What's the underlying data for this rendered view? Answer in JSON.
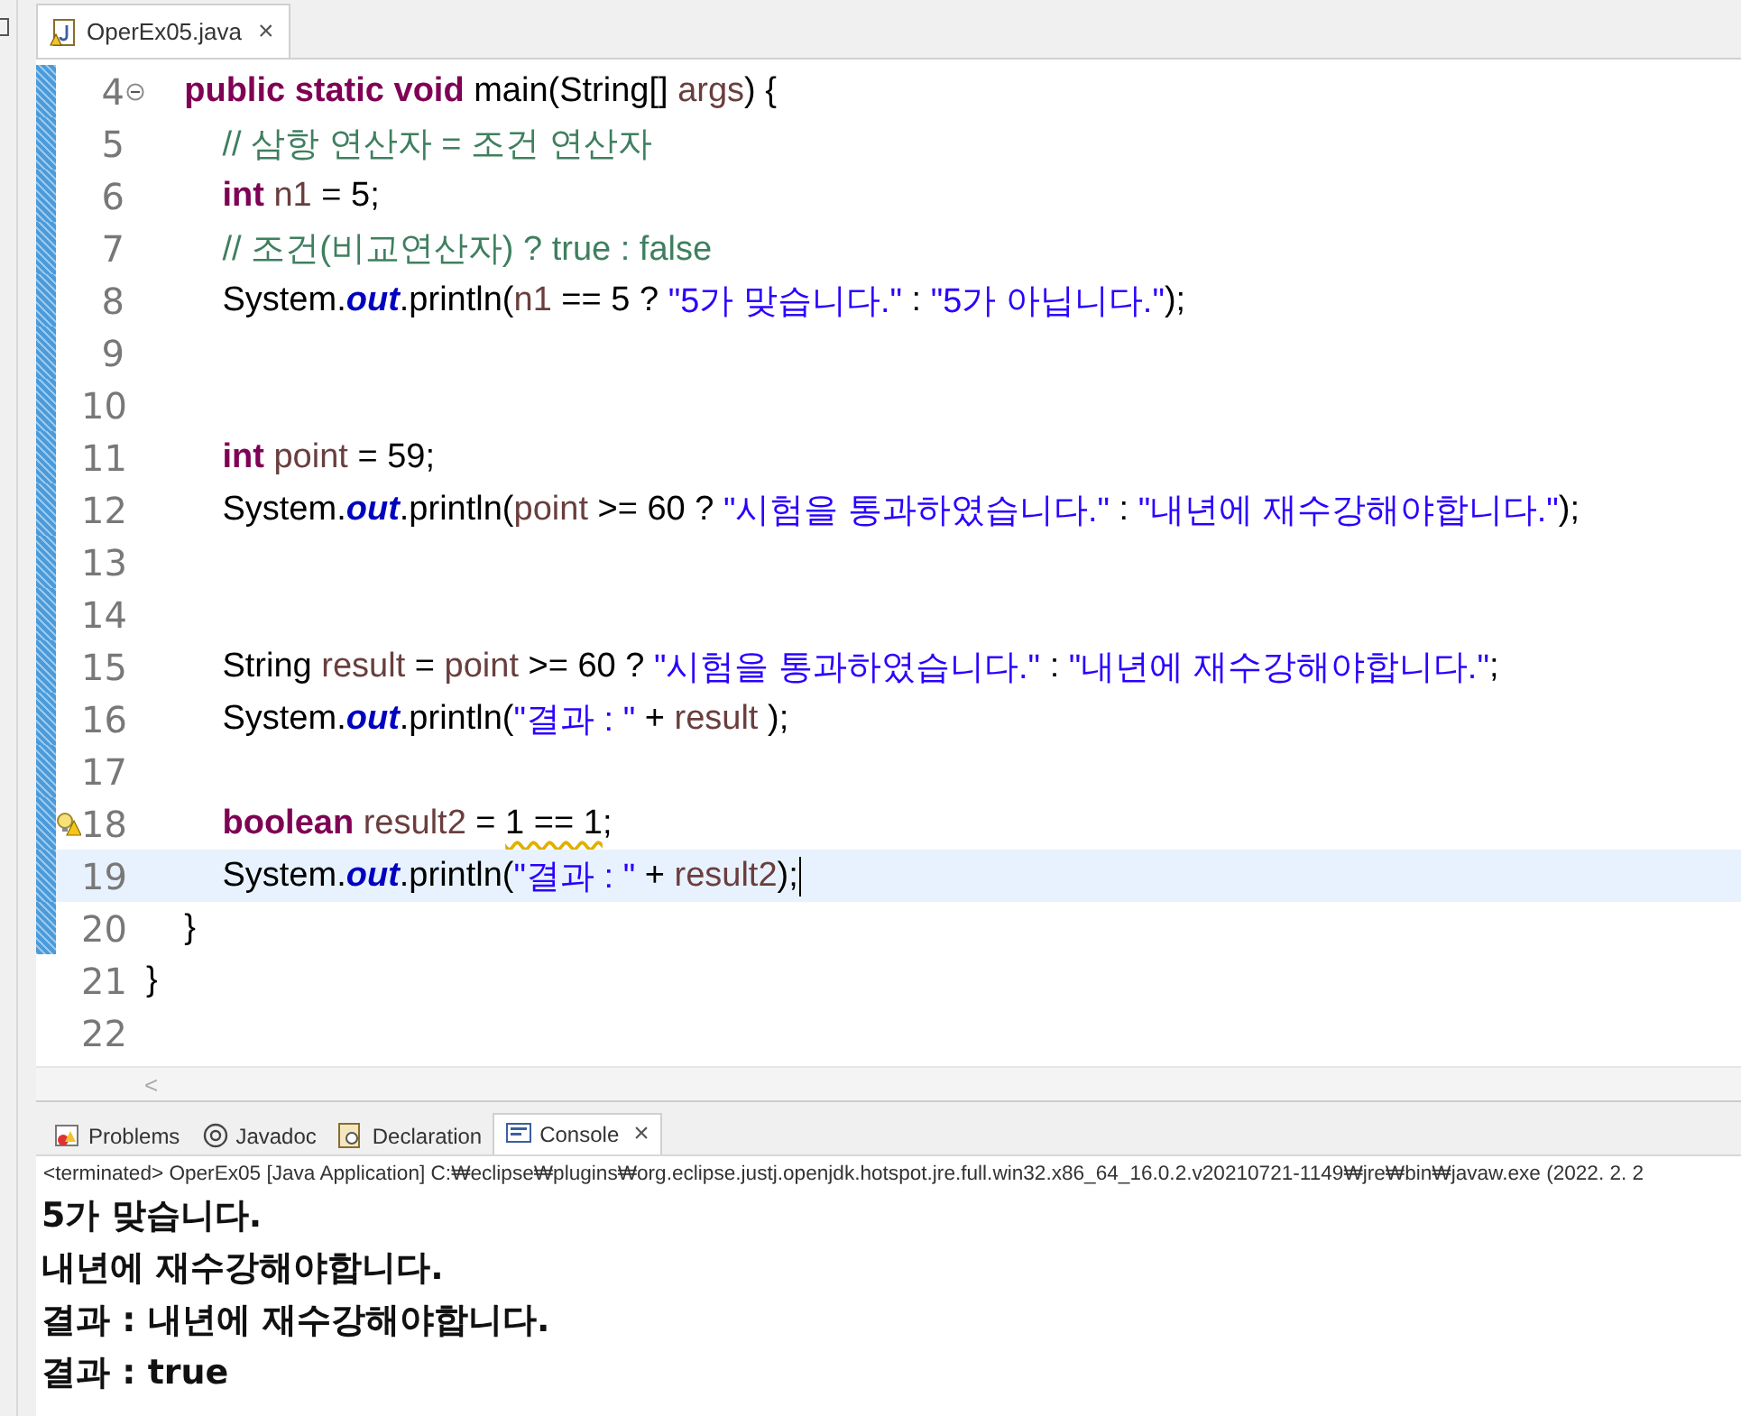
{
  "editor_tab": {
    "title": "OperEx05.java",
    "selected": true,
    "close": "×"
  },
  "code_lines": [
    {
      "number": "4",
      "kind": "fold",
      "changed": true,
      "current": false,
      "tokens": [
        {
          "kind": "keyword",
          "text": "    public static void"
        },
        {
          "kind": "plain",
          "text": " main(String[] "
        },
        {
          "kind": "variable",
          "text": "args"
        },
        {
          "kind": "plain",
          "text": ") {"
        }
      ]
    },
    {
      "number": "5",
      "kind": "plain",
      "changed": true,
      "current": false,
      "tokens": [
        {
          "kind": "comment",
          "text": "        // 삼항 연산자 = 조건 연산자"
        }
      ]
    },
    {
      "number": "6",
      "kind": "plain",
      "changed": true,
      "current": false,
      "tokens": [
        {
          "kind": "keyword",
          "text": "        int"
        },
        {
          "kind": "variable",
          "text": " n1"
        },
        {
          "kind": "plain",
          "text": " = 5;"
        }
      ]
    },
    {
      "number": "7",
      "kind": "plain",
      "changed": true,
      "current": false,
      "tokens": [
        {
          "kind": "comment",
          "text": "        // 조건(비교연산자) ? true : false"
        }
      ]
    },
    {
      "number": "8",
      "kind": "plain",
      "changed": true,
      "current": false,
      "tokens": [
        {
          "kind": "plain",
          "text": "        System."
        },
        {
          "kind": "field",
          "text": "out"
        },
        {
          "kind": "plain",
          "text": ".println("
        },
        {
          "kind": "variable",
          "text": "n1"
        },
        {
          "kind": "plain",
          "text": " == 5 ? "
        },
        {
          "kind": "string",
          "text": "\"5가 맞습니다.\""
        },
        {
          "kind": "plain",
          "text": " : "
        },
        {
          "kind": "string",
          "text": "\"5가 아닙니다.\""
        },
        {
          "kind": "plain",
          "text": ");"
        }
      ]
    },
    {
      "number": "9",
      "kind": "plain",
      "changed": true,
      "current": false
    },
    {
      "number": "10",
      "kind": "plain",
      "changed": true,
      "current": false
    },
    {
      "number": "11",
      "kind": "plain",
      "changed": true,
      "current": false,
      "tokens": [
        {
          "kind": "keyword",
          "text": "        int"
        },
        {
          "kind": "variable",
          "text": " point"
        },
        {
          "kind": "plain",
          "text": " = 59;"
        }
      ]
    },
    {
      "number": "12",
      "kind": "plain",
      "changed": true,
      "current": false,
      "tokens": [
        {
          "kind": "plain",
          "text": "        System."
        },
        {
          "kind": "field",
          "text": "out"
        },
        {
          "kind": "plain",
          "text": ".println("
        },
        {
          "kind": "variable",
          "text": "point"
        },
        {
          "kind": "plain",
          "text": " >= 60 ? "
        },
        {
          "kind": "string",
          "text": "\"시험을 통과하였습니다.\""
        },
        {
          "kind": "plain",
          "text": " : "
        },
        {
          "kind": "string",
          "text": "\"내년에 재수강해야합니다.\""
        },
        {
          "kind": "plain",
          "text": ");"
        }
      ]
    },
    {
      "number": "13",
      "kind": "plain",
      "changed": true,
      "current": false
    },
    {
      "number": "14",
      "kind": "plain",
      "changed": true,
      "current": false
    },
    {
      "number": "15",
      "kind": "plain",
      "changed": true,
      "current": false,
      "tokens": [
        {
          "kind": "plain",
          "text": "        String "
        },
        {
          "kind": "variable",
          "text": "result"
        },
        {
          "kind": "plain",
          "text": " = "
        },
        {
          "kind": "variable",
          "text": "point"
        },
        {
          "kind": "plain",
          "text": " >= 60 ? "
        },
        {
          "kind": "string",
          "text": "\"시험을 통과하였습니다.\""
        },
        {
          "kind": "plain",
          "text": " : "
        },
        {
          "kind": "string",
          "text": "\"내년에 재수강해야합니다.\""
        },
        {
          "kind": "plain",
          "text": ";"
        }
      ]
    },
    {
      "number": "16",
      "kind": "plain",
      "changed": true,
      "current": false,
      "tokens": [
        {
          "kind": "plain",
          "text": "        System."
        },
        {
          "kind": "field",
          "text": "out"
        },
        {
          "kind": "plain",
          "text": ".println("
        },
        {
          "kind": "string",
          "text": "\"결과 : \""
        },
        {
          "kind": "plain",
          "text": " + "
        },
        {
          "kind": "variable",
          "text": "result"
        },
        {
          "kind": "plain",
          "text": " );"
        }
      ]
    },
    {
      "number": "17",
      "kind": "plain",
      "changed": true,
      "current": false
    },
    {
      "number": "18",
      "kind": "warning",
      "changed": true,
      "current": false,
      "tokens": [
        {
          "kind": "keyword",
          "text": "        boolean"
        },
        {
          "kind": "variable",
          "text": " result2"
        },
        {
          "kind": "plain",
          "text": " = "
        },
        {
          "kind": "warn",
          "text": "1 == 1"
        },
        {
          "kind": "plain",
          "text": ";"
        }
      ]
    },
    {
      "number": "19",
      "kind": "plain",
      "changed": true,
      "current": true,
      "tokens": [
        {
          "kind": "plain",
          "text": "        System."
        },
        {
          "kind": "field",
          "text": "out"
        },
        {
          "kind": "plain",
          "text": ".println("
        },
        {
          "kind": "string",
          "text": "\"결과 : \""
        },
        {
          "kind": "plain",
          "text": " + "
        },
        {
          "kind": "variable",
          "text": "result2"
        },
        {
          "kind": "plain",
          "text": ");"
        }
      ]
    },
    {
      "number": "20",
      "kind": "plain",
      "changed": true,
      "current": false,
      "tokens": [
        {
          "kind": "plain",
          "text": "    }"
        }
      ]
    },
    {
      "number": "21",
      "kind": "plain",
      "changed": false,
      "current": false,
      "tokens": [
        {
          "kind": "plain",
          "text": "}"
        }
      ]
    },
    {
      "number": "22",
      "kind": "plain",
      "changed": false,
      "current": false
    }
  ],
  "scroll_left": "<",
  "panel_tabs": [
    {
      "label": "Problems",
      "selected": false
    },
    {
      "label": "Javadoc",
      "selected": false
    },
    {
      "label": "Declaration",
      "selected": false
    },
    {
      "label": "Console",
      "selected": true,
      "close": "×"
    }
  ],
  "console_header": "<terminated> OperEx05 [Java Application] C:₩eclipse₩plugins₩org.eclipse.justj.openjdk.hotspot.jre.full.win32.x86_64_16.0.2.v20210721-1149₩jre₩bin₩javaw.exe  (2022. 2. 2",
  "console_output": [
    "5가 맞습니다.",
    "내년에 재수강해야합니다.",
    "결과 : 내년에 재수강해야합니다.",
    "결과 : true"
  ]
}
